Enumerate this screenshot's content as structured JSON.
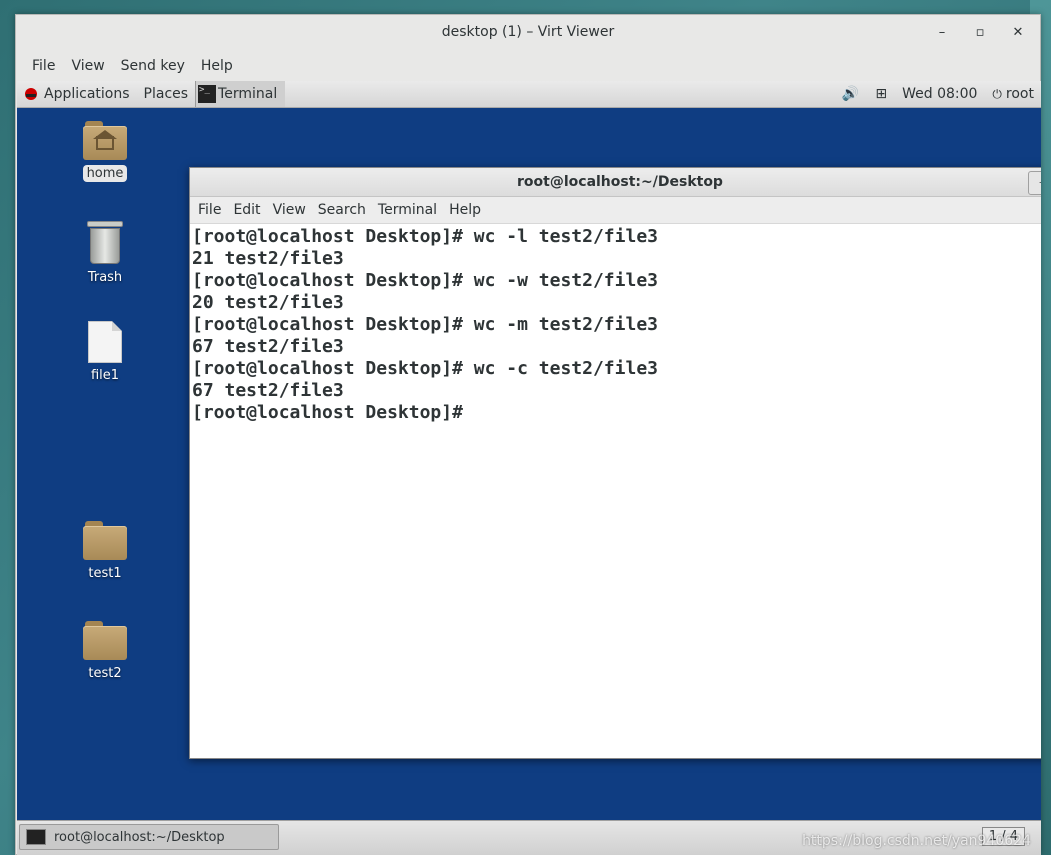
{
  "window": {
    "title": "desktop (1) – Virt Viewer",
    "minimize": "–",
    "maximize": "▫",
    "close": "✕"
  },
  "vv_menu": [
    "File",
    "View",
    "Send key",
    "Help"
  ],
  "gnome_top": {
    "applications": "Applications",
    "places": "Places",
    "task": "Terminal",
    "clock": "Wed 08:00",
    "user": "root",
    "volume_icon": "🔊",
    "network_icon": "⊞",
    "power_icon": "⏻"
  },
  "desktop_icons": [
    {
      "label": "home",
      "icon": "home-folder-icon"
    },
    {
      "label": "Trash",
      "icon": "trash-icon"
    },
    {
      "label": "file1",
      "icon": "document-icon"
    },
    {
      "label": "test1",
      "icon": "folder-icon"
    },
    {
      "label": "test2",
      "icon": "folder-icon"
    }
  ],
  "terminal": {
    "title": "root@localhost:~/Desktop",
    "menu": [
      "File",
      "Edit",
      "View",
      "Search",
      "Terminal",
      "Help"
    ],
    "lines": [
      "[root@localhost Desktop]# wc -l test2/file3",
      "21 test2/file3",
      "[root@localhost Desktop]# wc -w test2/file3",
      "20 test2/file3",
      "[root@localhost Desktop]# wc -m test2/file3",
      "67 test2/file3",
      "[root@localhost Desktop]# wc -c test2/file3",
      "67 test2/file3",
      "[root@localhost Desktop]# "
    ]
  },
  "bottom_bar": {
    "task_label": "root@localhost:~/Desktop",
    "pager": "1 / 4",
    "watermark": "https://blog.csdn.net/yan940624"
  }
}
